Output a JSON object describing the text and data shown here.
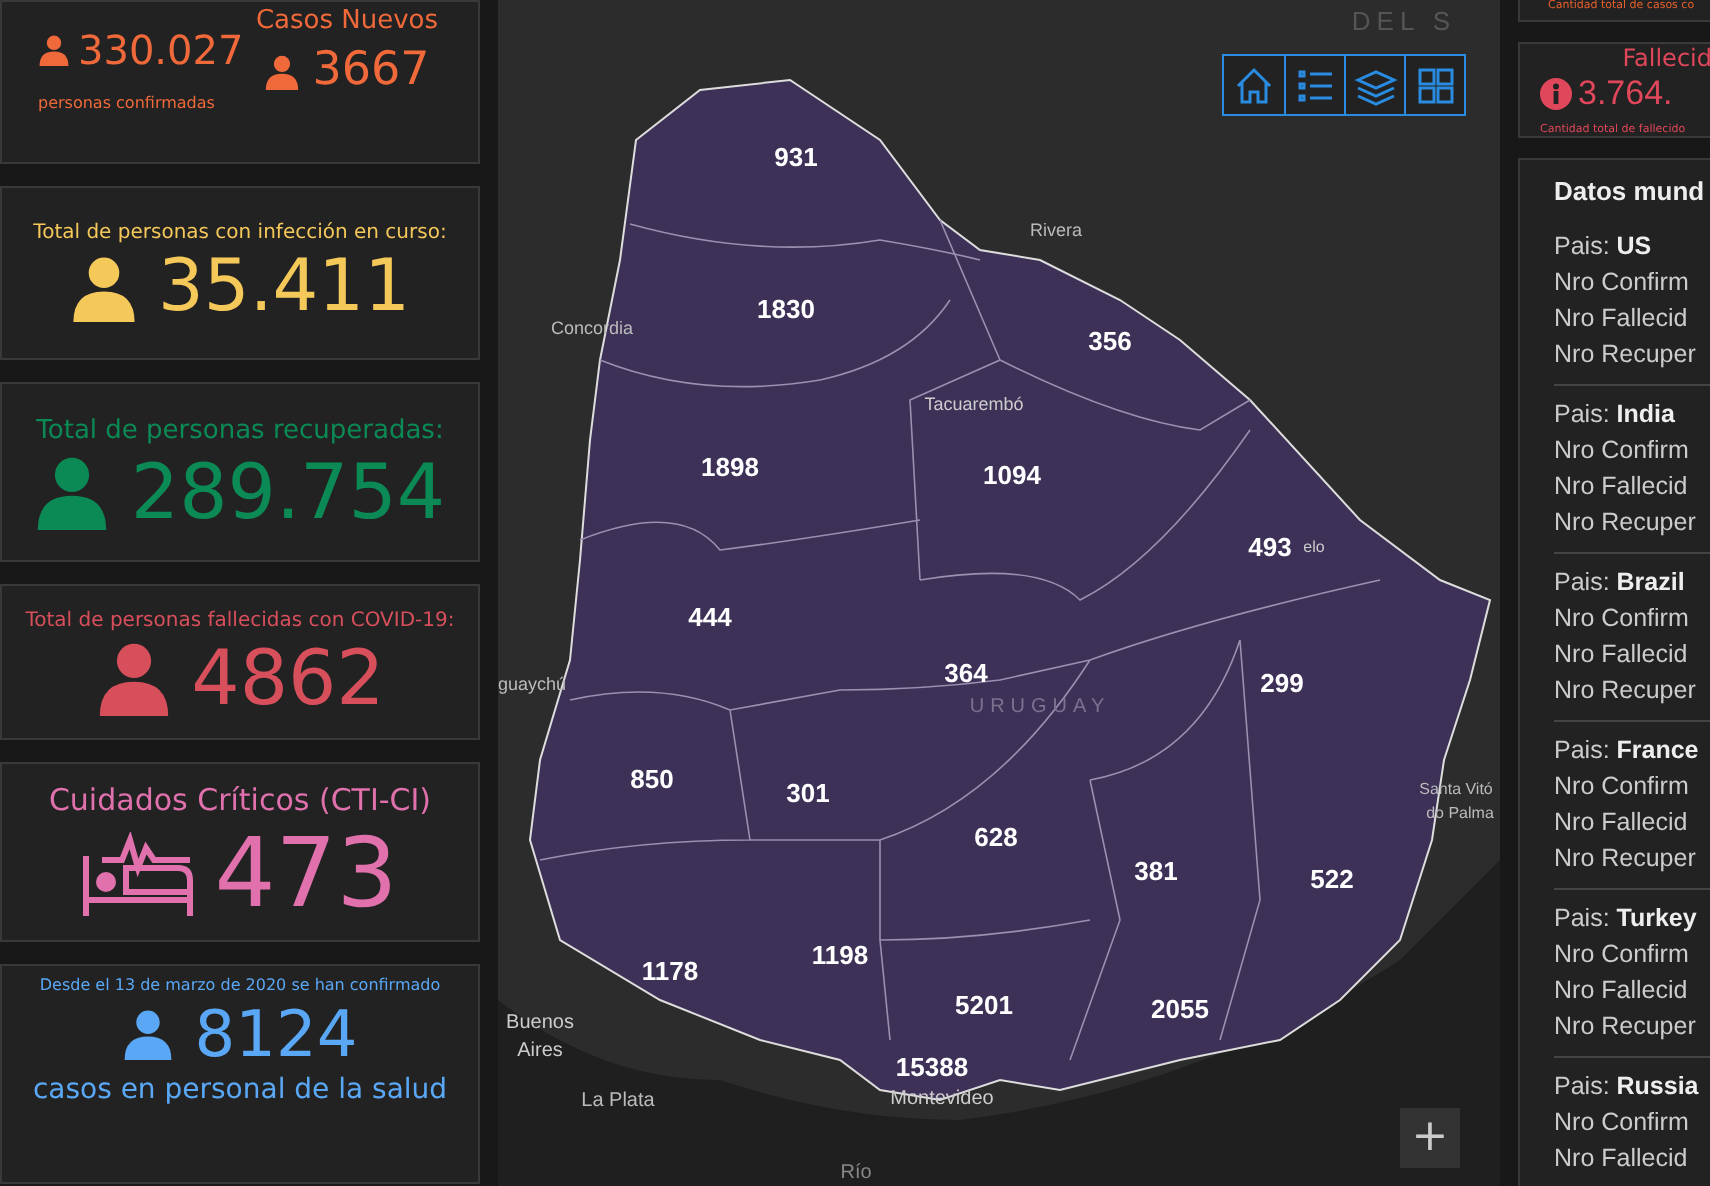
{
  "left_panel": {
    "cards": [
      {
        "kind": "split",
        "color": "#f0693a",
        "value": "330.027",
        "caption": "personas confirmadas",
        "new_title": "Casos Nuevos",
        "new_value": "3667"
      },
      {
        "kind": "person",
        "color": "#f5c85a",
        "title": "Total de personas con infección en curso:",
        "value": "35.411"
      },
      {
        "kind": "person",
        "color": "#0b8a55",
        "title": "Total de personas recuperadas:",
        "value": "289.754"
      },
      {
        "kind": "person",
        "color": "#d84f5c",
        "title": "Total de personas fallecidas con COVID-19:",
        "value": "4862"
      },
      {
        "kind": "bed",
        "color": "#e071ad",
        "title": "Cuidados Críticos (CTI-CI)",
        "value": "473"
      },
      {
        "kind": "staff",
        "color": "#5aa8f5",
        "title": "Desde el 13 de marzo de 2020 se han confirmado",
        "value": "8124",
        "caption": "casos en personal de la salud"
      }
    ]
  },
  "map": {
    "departments": [
      {
        "cases": "931"
      },
      {
        "cases": "1830"
      },
      {
        "cases": "356"
      },
      {
        "cases": "1898"
      },
      {
        "cases": "1094"
      },
      {
        "cases": "493"
      },
      {
        "cases": "444"
      },
      {
        "cases": "364"
      },
      {
        "cases": "299"
      },
      {
        "cases": "850"
      },
      {
        "cases": "301"
      },
      {
        "cases": "628"
      },
      {
        "cases": "381"
      },
      {
        "cases": "522"
      },
      {
        "cases": "1178"
      },
      {
        "cases": "1198"
      },
      {
        "cases": "5201"
      },
      {
        "cases": "2055"
      },
      {
        "cases": "15388"
      }
    ],
    "places": [
      {
        "name": "DEL S"
      },
      {
        "name": "Rivera"
      },
      {
        "name": "Concordia"
      },
      {
        "name": "Tacuarembó"
      },
      {
        "name": "elo"
      },
      {
        "name": "URUGUAY"
      },
      {
        "name": "guaychú"
      },
      {
        "name": "Santa Vitó"
      },
      {
        "name": "do Palma"
      },
      {
        "name": "Buenos"
      },
      {
        "name": "Aires"
      },
      {
        "name": "La Plata"
      },
      {
        "name": "Montevideo"
      },
      {
        "name": "Río"
      }
    ],
    "zoom_in": "+"
  },
  "right_panel": {
    "top_card": {
      "caption": "Cantidad total de casos co",
      "color": "#e8602c"
    },
    "deaths_card": {
      "title": "Fallecid",
      "value": "3.764.",
      "caption": "Cantidad total de fallecido",
      "color": "#e0475a"
    },
    "world": {
      "title": "Datos mund",
      "countries": [
        {
          "label": "Pais:",
          "name": "US",
          "lines": [
            "Nro Confirm",
            "Nro Fallecid",
            "Nro Recuper"
          ]
        },
        {
          "label": "Pais:",
          "name": "India",
          "lines": [
            "Nro Confirm",
            "Nro Fallecid",
            "Nro Recuper"
          ]
        },
        {
          "label": "Pais:",
          "name": "Brazil",
          "lines": [
            "Nro Confirm",
            "Nro Fallecid",
            "Nro Recuper"
          ]
        },
        {
          "label": "Pais:",
          "name": "France",
          "lines": [
            "Nro Confirm",
            "Nro Fallecid",
            "Nro Recuper"
          ]
        },
        {
          "label": "Pais:",
          "name": "Turkey",
          "lines": [
            "Nro Confirm",
            "Nro Fallecid",
            "Nro Recuper"
          ]
        },
        {
          "label": "Pais:",
          "name": "Russia",
          "lines": [
            "Nro Confirm",
            "Nro Fallecid"
          ]
        }
      ]
    }
  }
}
